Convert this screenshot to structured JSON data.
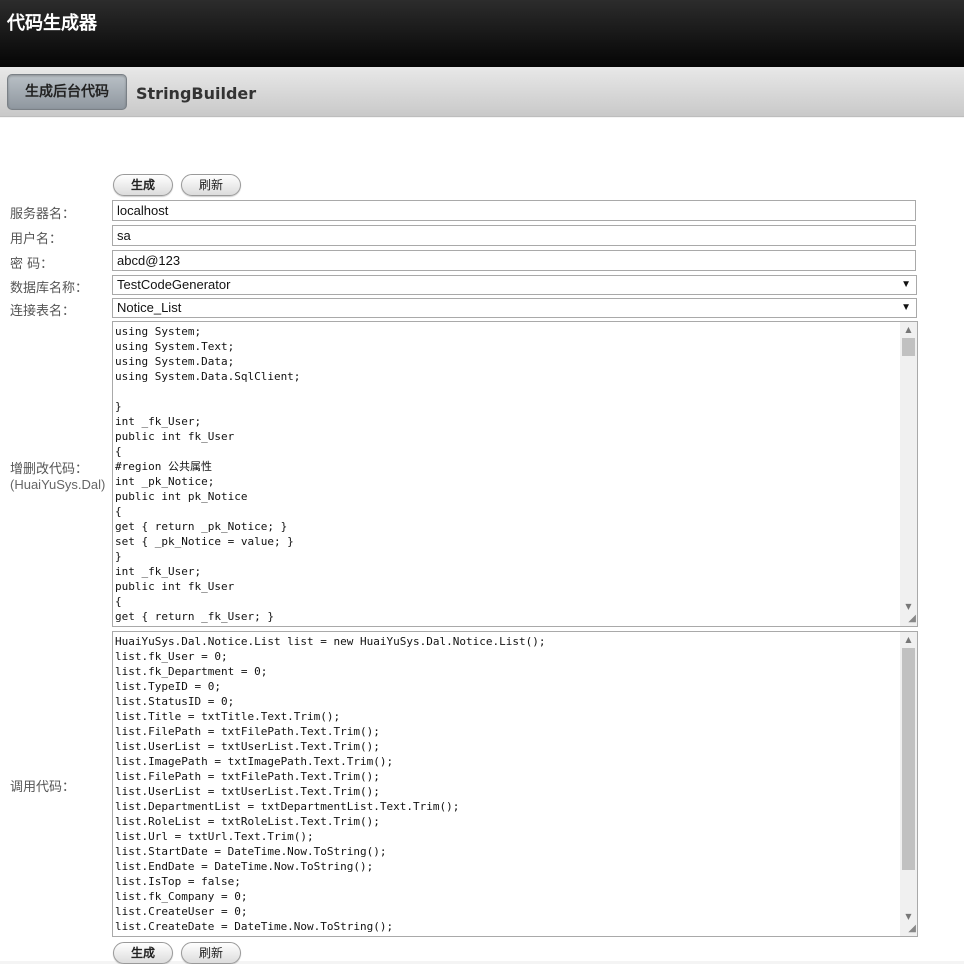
{
  "app": {
    "title": "代码生成器"
  },
  "tabs": [
    {
      "label": "生成后台代码"
    },
    {
      "label": "StringBuilder"
    }
  ],
  "buttons": {
    "generate": "生成",
    "refresh": "刷新"
  },
  "form": {
    "server_label": "服务器名：",
    "server_value": "localhost",
    "user_label": "用户名：",
    "user_value": "sa",
    "password_label": "密 码：",
    "password_value": "abcd@123",
    "database_label": "数据库名称：",
    "database_value": "TestCodeGenerator",
    "table_label": "连接表名：",
    "table_value": "Notice_List",
    "crud_label": "增删改代码：",
    "crud_sublabel": "(HuaiYuSys.Dal)",
    "call_label": "调用代码："
  },
  "crud_code_lines": [
    "using System;",
    "using System.Text;",
    "using System.Data;",
    "using System.Data.SqlClient;",
    "",
    "}",
    "int _fk_User;",
    "public int fk_User",
    "{",
    "#region 公共属性",
    "int _pk_Notice;",
    "public int pk_Notice",
    "{",
    "get { return _pk_Notice; }",
    "set { _pk_Notice = value; }",
    "}",
    "int _fk_User;",
    "public int fk_User",
    "{",
    "get { return _fk_User; }"
  ],
  "call_code_lines": [
    "HuaiYuSys.Dal.Notice.List list = new HuaiYuSys.Dal.Notice.List();",
    "list.fk_User = 0;",
    "list.fk_Department = 0;",
    "list.TypeID = 0;",
    "list.StatusID = 0;",
    "list.Title = txtTitle.Text.Trim();",
    "list.FilePath = txtFilePath.Text.Trim();",
    "list.UserList = txtUserList.Text.Trim();",
    "list.ImagePath = txtImagePath.Text.Trim();",
    "list.FilePath = txtFilePath.Text.Trim();",
    "list.UserList = txtUserList.Text.Trim();",
    "list.DepartmentList = txtDepartmentList.Text.Trim();",
    "list.RoleList = txtRoleList.Text.Trim();",
    "list.Url = txtUrl.Text.Trim();",
    "list.StartDate = DateTime.Now.ToString();",
    "list.EndDate = DateTime.Now.ToString();",
    "list.IsTop = false;",
    "list.fk_Company = 0;",
    "list.CreateUser = 0;",
    "list.CreateDate = DateTime.Now.ToString();"
  ]
}
